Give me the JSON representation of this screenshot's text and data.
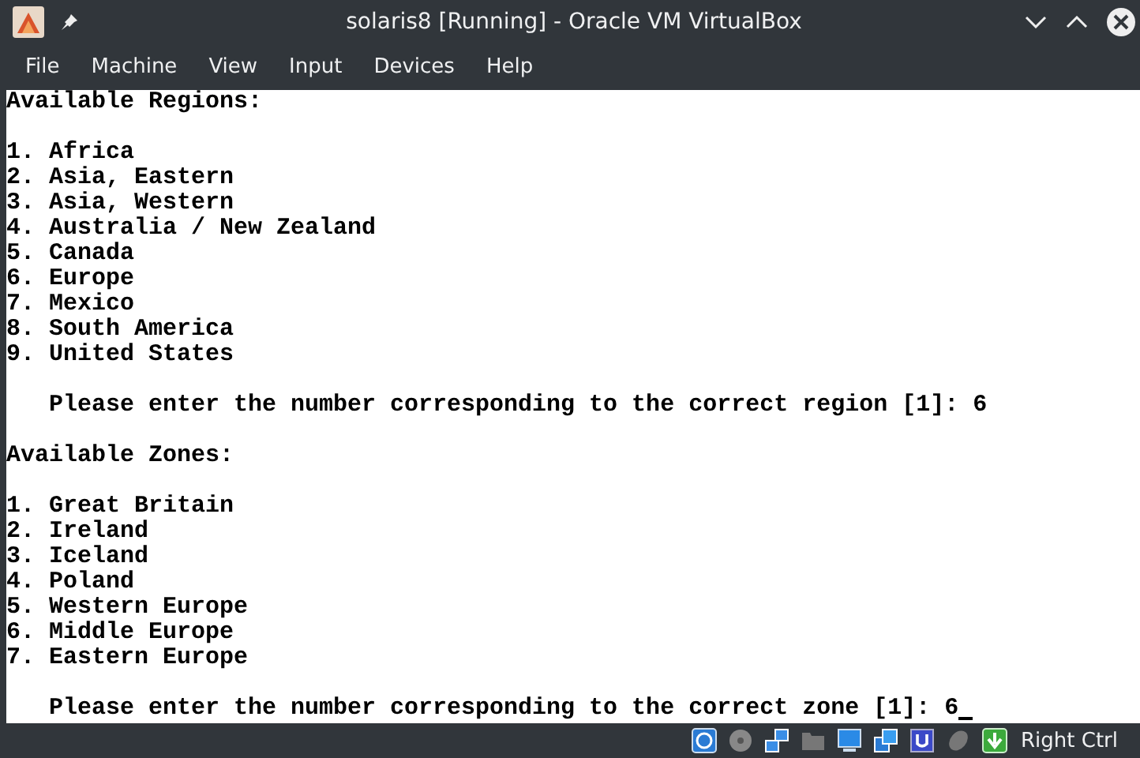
{
  "window": {
    "title": "solaris8 [Running] - Oracle VM VirtualBox"
  },
  "menu": [
    "File",
    "Machine",
    "View",
    "Input",
    "Devices",
    "Help"
  ],
  "console": {
    "sections": [
      {
        "heading": "Available Regions:",
        "items": [
          "1. Africa",
          "2. Asia, Eastern",
          "3. Asia, Western",
          "4. Australia / New Zealand",
          "5. Canada",
          "6. Europe",
          "7. Mexico",
          "8. South America",
          "9. United States"
        ],
        "prompt": "Please enter the number corresponding to the correct region [1]: 6"
      },
      {
        "heading": "Available Zones:",
        "items": [
          "1. Great Britain",
          "2. Ireland",
          "3. Iceland",
          "4. Poland",
          "5. Western Europe",
          "6. Middle Europe",
          "7. Eastern Europe"
        ],
        "prompt": "Please enter the number corresponding to the correct zone [1]: 6"
      }
    ]
  },
  "status_bar": {
    "host_key": "Right Ctrl"
  }
}
